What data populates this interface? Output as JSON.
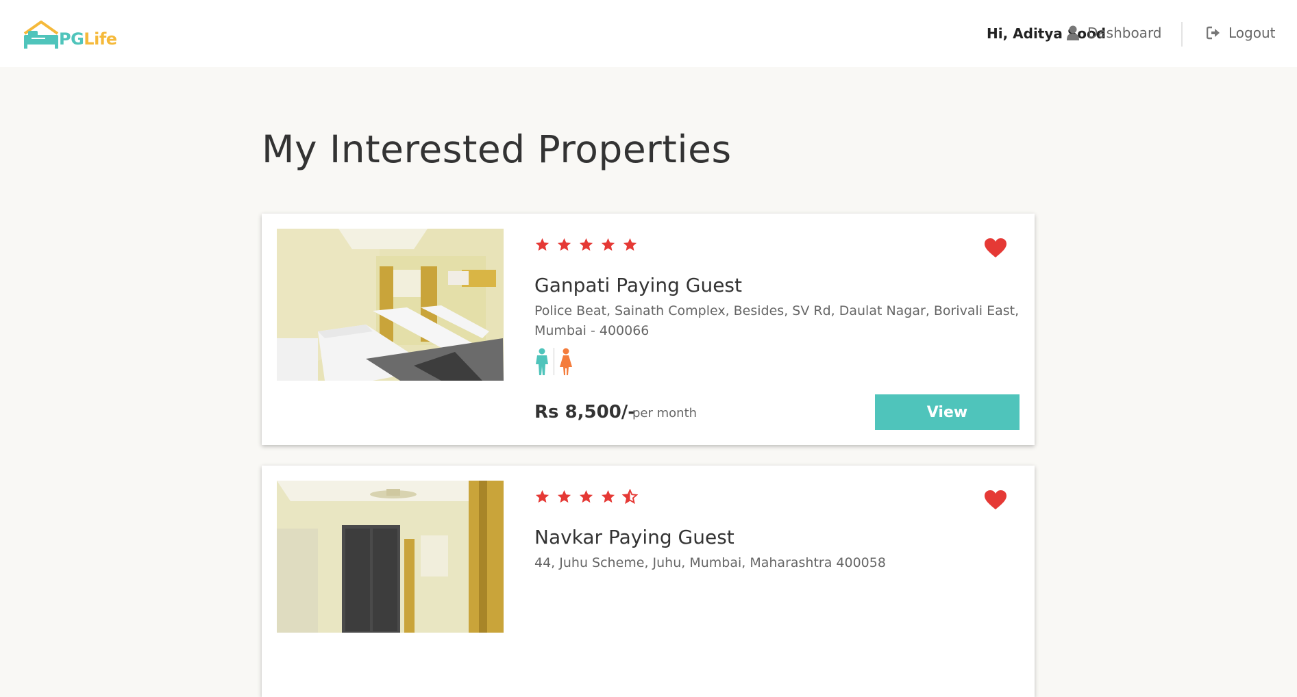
{
  "header": {
    "logo_pg": "PG",
    "logo_life": "Life",
    "greeting": "Hi, Aditya Sood",
    "dashboard_label": "Dashboard",
    "logout_label": "Logout"
  },
  "page_title": "My Interested Properties",
  "properties": [
    {
      "name": "Ganpati Paying Guest",
      "address": "Police Beat, Sainath Complex, Besides, SV Rd, Daulat Nagar, Borivali East, Mumbai - 400066",
      "rating": 5,
      "gender": "unisex",
      "price": "Rs 8,500/-",
      "price_unit": "per month",
      "view_label": "View",
      "interested": true
    },
    {
      "name": "Navkar Paying Guest",
      "address": "44, Juhu Scheme, Juhu, Mumbai, Maharashtra 400058",
      "rating": 4.5,
      "interested": true
    }
  ],
  "colors": {
    "accent": "#4fc4bb",
    "star": "#e53935",
    "heart": "#e53935",
    "logo_yellow": "#f5b93a",
    "female": "#f47c3c"
  }
}
